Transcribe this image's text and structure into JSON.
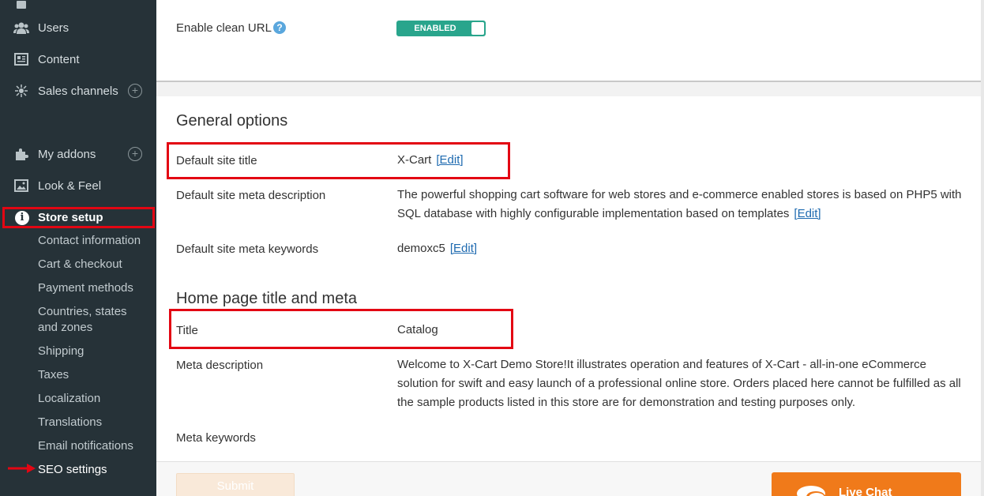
{
  "sidebar": {
    "items": [
      {
        "label": "Users",
        "icon": "users-icon"
      },
      {
        "label": "Content",
        "icon": "content-icon"
      },
      {
        "label": "Sales channels",
        "icon": "sales-channels-icon"
      },
      {
        "label": "My addons",
        "icon": "puzzle-icon"
      },
      {
        "label": "Look & Feel",
        "icon": "image-icon"
      }
    ],
    "store_setup": {
      "label": "Store setup",
      "icon": "info-icon"
    },
    "sub_items": [
      "Contact information",
      "Cart & checkout",
      "Payment methods",
      "Countries, states",
      "and zones",
      "Shipping",
      "Taxes",
      "Localization",
      "Translations",
      "Email notifications",
      "SEO settings"
    ]
  },
  "clean_url": {
    "label": "Enable clean URL",
    "toggle_label": "ENABLED",
    "toggle_state": "on"
  },
  "general_options": {
    "heading": "General options",
    "rows": [
      {
        "label": "Default site title",
        "value": "X-Cart",
        "link": "[Edit]"
      },
      {
        "label": "Default site meta description",
        "value": "The powerful shopping cart software for web stores and e-commerce enabled stores is based on PHP5 with SQL database with highly configurable implementation based on templates",
        "link": "[Edit]"
      },
      {
        "label": "Default site meta keywords",
        "value": "demoxc5",
        "link": "[Edit]"
      }
    ]
  },
  "home_page": {
    "heading": "Home page title and meta",
    "rows": [
      {
        "label": "Title",
        "value": "Catalog"
      },
      {
        "label": "Meta description",
        "value": "Welcome to X-Cart Demo Store!It illustrates operation and features of X-Cart - all-in-one eCommerce solution for swift and easy launch of a professional online store. Orders placed here cannot be fulfilled as all the sample products listed in this store are for demonstration and testing purposes only."
      },
      {
        "label": "Meta keywords",
        "value": ""
      }
    ]
  },
  "footer": {
    "submit_label": "Submit",
    "live_chat_label": "Live Chat"
  },
  "colors": {
    "sidebar_bg": "#263238",
    "toggle_on": "#29a58c",
    "highlight": "#e30613",
    "link": "#1e6ab0",
    "live_chat": "#f07a1a"
  }
}
